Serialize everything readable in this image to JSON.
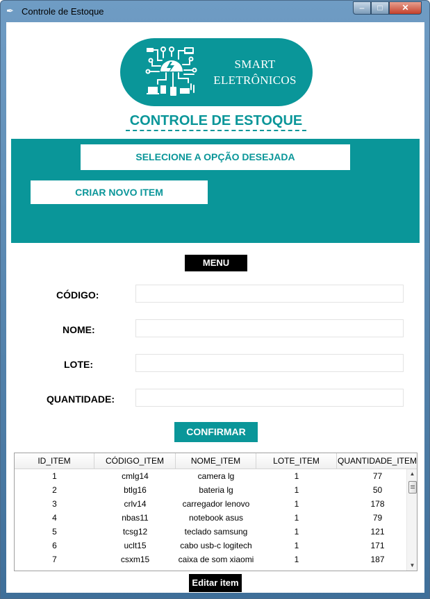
{
  "window": {
    "title": "Controle de Estoque",
    "controls": {
      "minimize": "–",
      "maximize": "□",
      "close": "✕"
    }
  },
  "logo": {
    "line1": "SMART",
    "line2": "ELETRÔNICOS"
  },
  "heading": "CONTROLE DE ESTOQUE",
  "panel": {
    "title": "SELECIONE A OPÇÃO DESEJADA",
    "create_button": "CRIAR NOVO ITEM"
  },
  "menu_button": "MENU",
  "form": {
    "fields": [
      {
        "label": "CÓDIGO:",
        "value": ""
      },
      {
        "label": "NOME:",
        "value": ""
      },
      {
        "label": "LOTE:",
        "value": ""
      },
      {
        "label": "QUANTIDADE:",
        "value": ""
      }
    ],
    "confirm_button": "CONFIRMAR"
  },
  "table": {
    "columns": [
      "ID_ITEM",
      "CÓDIGO_ITEM",
      "NOME_ITEM",
      "LOTE_ITEM",
      "QUANTIDADE_ITEM"
    ],
    "rows": [
      [
        "1",
        "cmlg14",
        "camera lg",
        "1",
        "77"
      ],
      [
        "2",
        "btlg16",
        "bateria lg",
        "1",
        "50"
      ],
      [
        "3",
        "crlv14",
        "carregador lenovo",
        "1",
        "178"
      ],
      [
        "4",
        "nbas11",
        "notebook asus",
        "1",
        "79"
      ],
      [
        "5",
        "tcsg12",
        "teclado samsung",
        "1",
        "121"
      ],
      [
        "6",
        "uclt15",
        "cabo usb-c logitech",
        "1",
        "171"
      ],
      [
        "7",
        "csxm15",
        "caixa de som xiaomi",
        "1",
        "187"
      ]
    ],
    "scroll_up": "▲",
    "scroll_down": "▼"
  },
  "edit_button": "Editar item",
  "colors": {
    "accent": "#0a9699",
    "dark": "#000000"
  },
  "icons": [
    "feather-icon",
    "circuit-chip-icon"
  ]
}
